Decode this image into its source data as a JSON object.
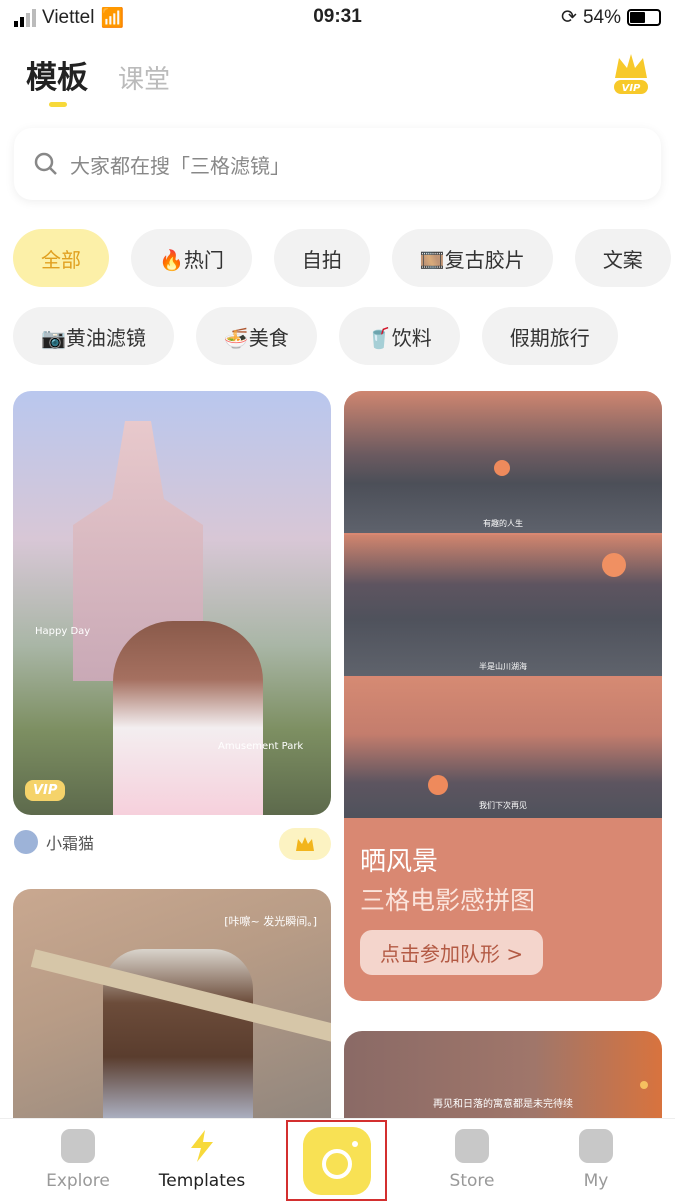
{
  "status": {
    "carrier": "Viettel",
    "time": "09:31",
    "battery": "54%"
  },
  "header": {
    "tabs": [
      {
        "label": "模板",
        "active": true
      },
      {
        "label": "课堂",
        "active": false
      }
    ],
    "vip_badge": "VIP"
  },
  "search": {
    "placeholder": "大家都在搜「三格滤镜」"
  },
  "chips_row1": [
    {
      "label": "全部",
      "active": true
    },
    {
      "label": "🔥热门"
    },
    {
      "label": "自拍"
    },
    {
      "label": "🎞️复古胶片"
    },
    {
      "label": "文案"
    }
  ],
  "chips_row2": [
    {
      "label": "📷黄油滤镜"
    },
    {
      "label": "🍜美食"
    },
    {
      "label": "🥤饮料"
    },
    {
      "label": "假期旅行"
    }
  ],
  "cards": {
    "castle": {
      "overlay1": "Happy Day",
      "overlay2": "Amusement Park",
      "vip": "VIP",
      "author": "小霜猫"
    },
    "sunset": {
      "captions": [
        "有趣的人生",
        "半是山川湖海",
        "我们下次再见"
      ],
      "title": "晒风景",
      "subtitle": "三格电影感拼图",
      "cta": "点击参加队形 >"
    },
    "coffee": {
      "caption": "[咔嚓~ 发光瞬间。]"
    },
    "sunset2": {
      "caption": "再见和日落的寓意都是未完待续"
    }
  },
  "nav": [
    {
      "label": "Explore"
    },
    {
      "label": "Templates",
      "active": true
    },
    {
      "label": ""
    },
    {
      "label": "Store"
    },
    {
      "label": "My"
    }
  ],
  "colors": {
    "accent": "#f7d93a",
    "cta_card": "#d98872",
    "highlight_box": "#d32f2f"
  }
}
